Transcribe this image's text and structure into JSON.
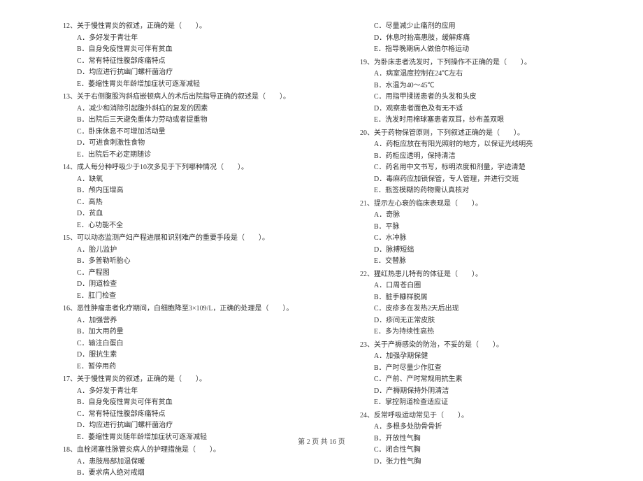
{
  "footer": "第 2 页 共 16 页",
  "left": {
    "q12": {
      "text": "12、关于慢性胃炎的叙述，正确的是（　　）。",
      "A": "A．多好发于青壮年",
      "B": "B．自身免疫性胃炎可伴有贫血",
      "C": "C．常有特征性腹部疼痛特点",
      "D": "D．均应进行抗幽门螺杆菌治疗",
      "E": "E．萎缩性胃炎年龄增加症状可逐渐减轻"
    },
    "q13": {
      "text": "13、关于右侧腹股沟斜疝嵌顿病人的术后出院指导正确的叙述是（　　）。",
      "A": "A．减少和消除引起腹外斜疝的复发的因素",
      "B": "B．出院后三天避免重体力劳动或者提重物",
      "C": "C．卧床休息不可增加活动量",
      "D": "D．可进食刺激性食物",
      "E": "E．出院后不必定期随诊"
    },
    "q14": {
      "text": "14、成人每分种呼吸少于10次多见于下列哪种情况（　　）。",
      "A": "A．缺氧",
      "B": "B．颅内压增高",
      "C": "C．高热",
      "D": "D．贫血",
      "E": "E．心功能不全"
    },
    "q15": {
      "text": "15、可以动态监测产妇产程进展和识别难产的重要手段是（　　）。",
      "A": "A．胎儿监护",
      "B": "B．多普勒听胎心",
      "C": "C．产程图",
      "D": "D．阴道检查",
      "E": "E．肛门检查"
    },
    "q16": {
      "text": "16、恶性肿瘤患者化疗期间，白细胞降至3×109/L，正确的处理是（　　）。",
      "A": "A．加强营养",
      "B": "B．加大用药量",
      "C": "C．输注白蛋白",
      "D": "D．服抗生素",
      "E": "E．暂停用药"
    },
    "q17": {
      "text": "17、关于慢性胃炎的叙述，正确的是（　　）。",
      "A": "A．多好发于青壮年",
      "B": "B．自身免疫性胃炎可伴有贫血",
      "C": "C．常有特征性腹部疼痛特点",
      "D": "D．均应进行抗幽门螺杆菌治疗",
      "E": "E．萎缩性胃炎随年龄增加症状可逐渐减轻"
    },
    "q18": {
      "text": "18、血栓闭塞性脉管炎病人的护理措施是（　　）。",
      "A": "A．患肢局部加温保暖",
      "B": "B．要求病人绝对戒烟"
    }
  },
  "right": {
    "q18cont": {
      "C": "C．尽量减少止痛剂的应用",
      "D": "D．休息时抬高患肢，缓解疼痛",
      "E": "E．指导晚期病人做伯尔格运动"
    },
    "q19": {
      "text": "19、为卧床患者洗发时，下列操作不正确的是（　　）。",
      "A": "A．病室温度控制在24℃左右",
      "B": "B．水温为40～45℃",
      "C": "C．用指甲揉搓患者的头发和头皮",
      "D": "D．观察患者面色及有无不适",
      "E": "E．洗发时用棉球塞患者双耳，纱布盖双眼"
    },
    "q20": {
      "text": "20、关于药物保管原则，下列叙述正确的是（　　）。",
      "A": "A．药柜应放在有阳光照射的地方，以保证光线明亮",
      "B": "B．药柜应透明，保持清洁",
      "C": "C．药名用中文书写，标明浓度和剂量，字迹清楚",
      "D": "D．毒麻药应加锁保管，专人管理，并进行交班",
      "E": "E．瓶签模糊的药物需认真核对"
    },
    "q21": {
      "text": "21、提示左心衰的临床表现是（　　）。",
      "A": "A．奇脉",
      "B": "B．平脉",
      "C": "C．水冲脉",
      "D": "D．脉搏短绌",
      "E": "E．交替脉"
    },
    "q22": {
      "text": "22、猩红热患儿特有的体征是（　　）。",
      "A": "A．口周苍白圈",
      "B": "B．脏手糠样脱屑",
      "C": "C．皮疹多在发热2天后出现",
      "D": "D．疹间无正常皮肤",
      "E": "E．多为持续性高热"
    },
    "q23": {
      "text": "23、关于产褥感染的防治，不妥的是（　　）。",
      "A": "A．加强孕期保健",
      "B": "B．产时尽量少作肛查",
      "C": "C．产前、产时常规用抗生素",
      "D": "D．产褥期保持外阴清洁",
      "E": "E．掌控阴道检查适应证"
    },
    "q24": {
      "text": "24、反常呼吸运动常见于（　　）。",
      "A": "A．多根多处肋骨骨折",
      "B": "B．开放性气胸",
      "C": "C．闭合性气胸",
      "D": "D．张力性气胸"
    }
  }
}
